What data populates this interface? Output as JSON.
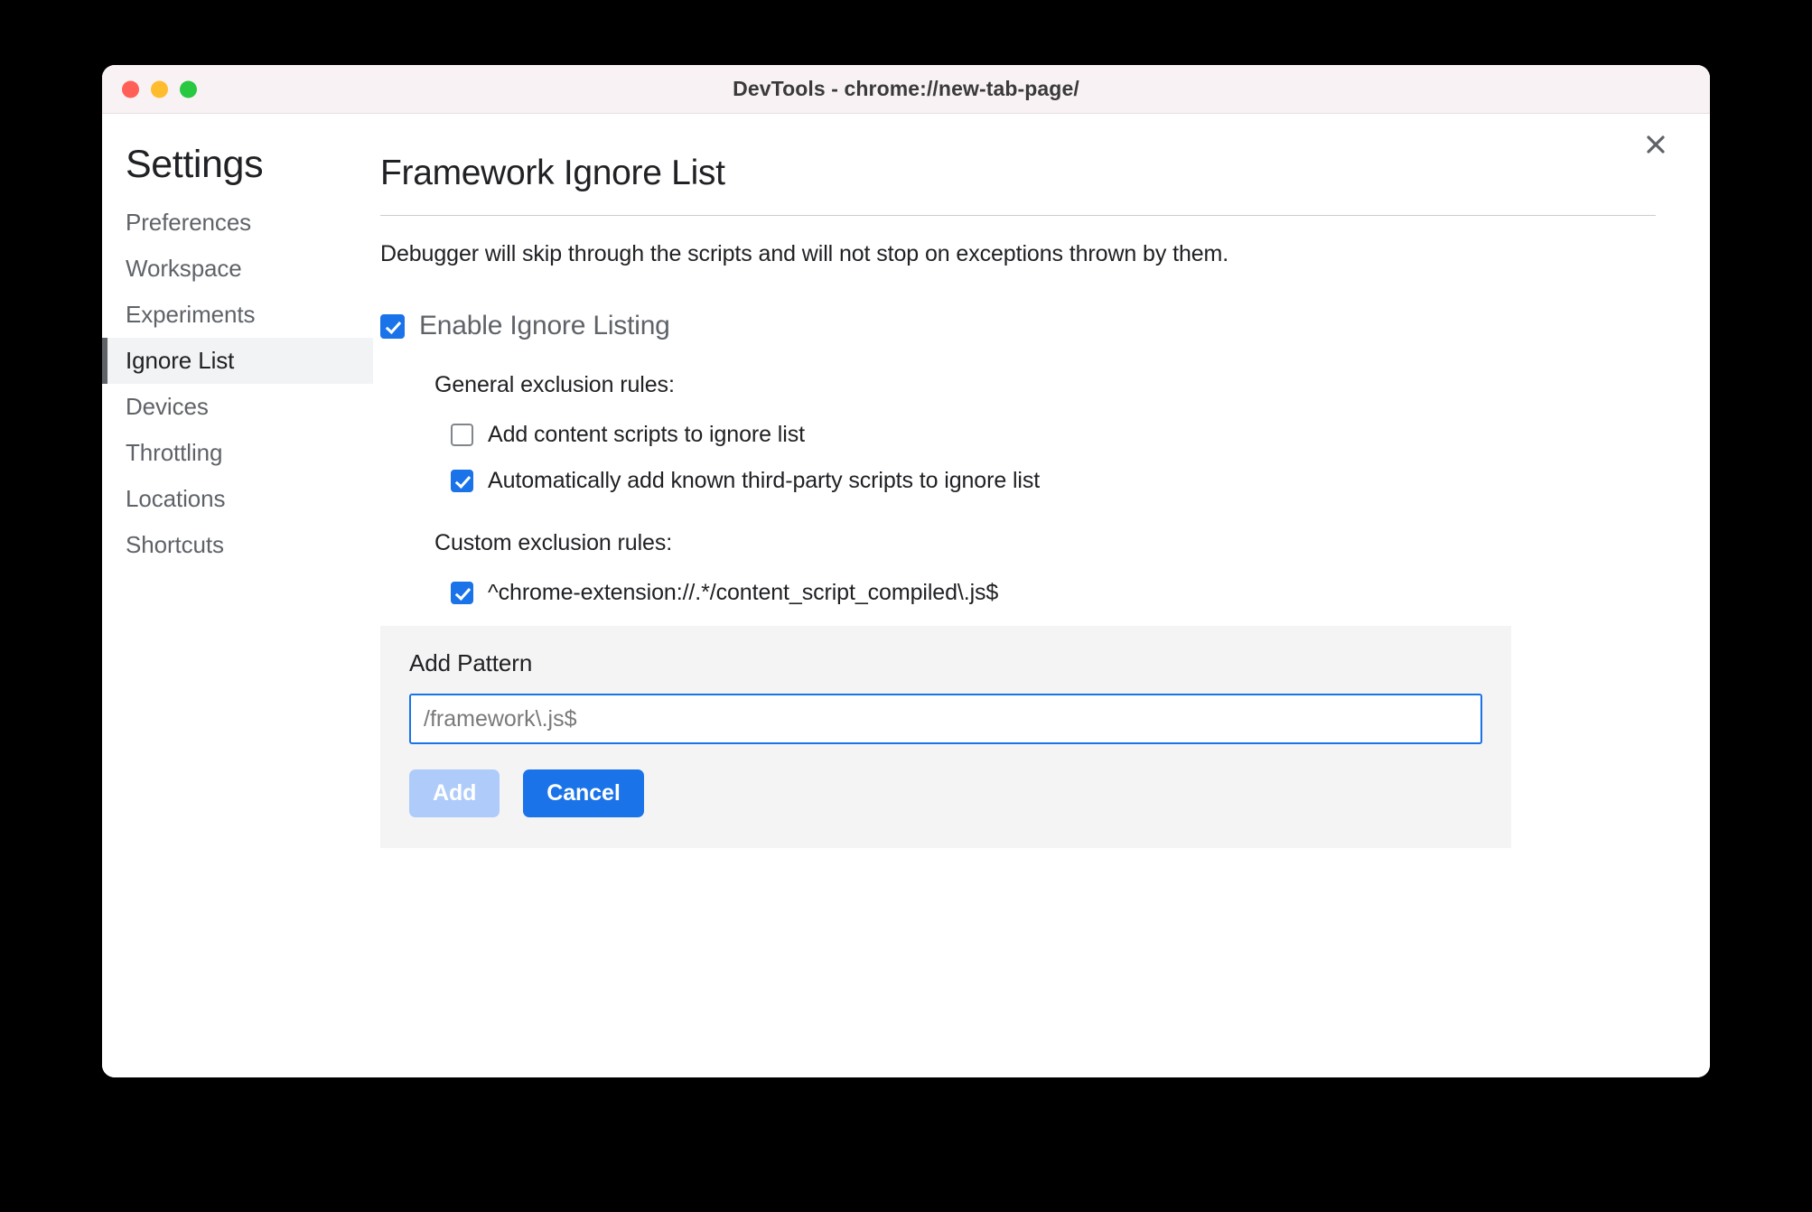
{
  "window": {
    "title": "DevTools - chrome://new-tab-page/",
    "traffic_lights": {
      "close": "#ff5f57",
      "minimize": "#febc2e",
      "maximize": "#28c840"
    }
  },
  "sidebar": {
    "title": "Settings",
    "items": [
      {
        "label": "Preferences",
        "selected": false
      },
      {
        "label": "Workspace",
        "selected": false
      },
      {
        "label": "Experiments",
        "selected": false
      },
      {
        "label": "Ignore List",
        "selected": true
      },
      {
        "label": "Devices",
        "selected": false
      },
      {
        "label": "Throttling",
        "selected": false
      },
      {
        "label": "Locations",
        "selected": false
      },
      {
        "label": "Shortcuts",
        "selected": false
      }
    ]
  },
  "content": {
    "close_label": "×",
    "page_title": "Framework Ignore List",
    "description": "Debugger will skip through the scripts and will not stop on exceptions thrown by them.",
    "enable_ignore_listing": {
      "label": "Enable Ignore Listing",
      "checked": true
    },
    "general_rules": {
      "title": "General exclusion rules:",
      "items": [
        {
          "label": "Add content scripts to ignore list",
          "checked": false
        },
        {
          "label": "Automatically add known third-party scripts to ignore list",
          "checked": true
        }
      ]
    },
    "custom_rules": {
      "title": "Custom exclusion rules:",
      "items": [
        {
          "label": "^chrome-extension://.*/content_script_compiled\\.js$",
          "checked": true
        }
      ]
    },
    "add_pattern": {
      "label": "Add Pattern",
      "input_value": "",
      "input_placeholder": "/framework\\.js$",
      "add_button": "Add",
      "cancel_button": "Cancel"
    }
  },
  "colors": {
    "accent_blue": "#1a73e8",
    "disabled_blue": "#aecbfa",
    "panel_gray": "#f4f4f4",
    "selected_nav": "#f1f3f4"
  }
}
